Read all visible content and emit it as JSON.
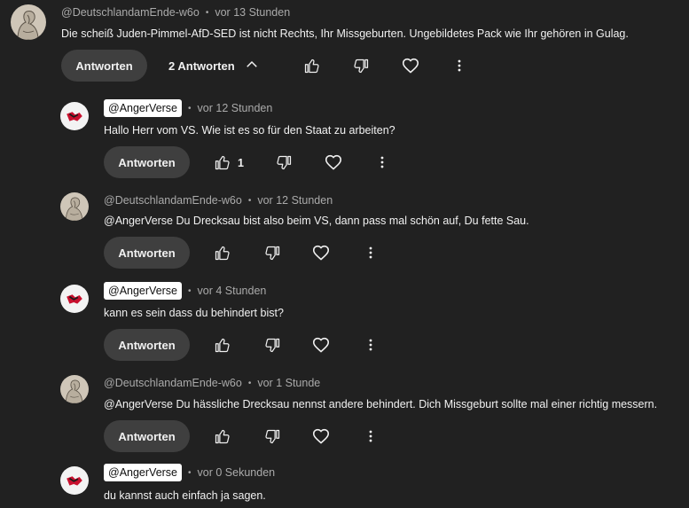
{
  "comments": [
    {
      "author": "@DeutschlandamEnde-w6o",
      "time": "vor 13 Stunden",
      "text": "Die scheiß Juden-Pimmel-AfD-SED ist nicht Rechts, Ihr Missgeburten.  Ungebildetes Pack wie Ihr gehören in Gulag.",
      "reply_label": "Antworten",
      "replies_toggle": "2 Antworten"
    },
    {
      "author": "@AngerVerse",
      "time": "vor 12 Stunden",
      "text": "Hallo Herr vom VS. Wie ist es so für den Staat zu arbeiten?",
      "reply_label": "Antworten",
      "like_count": "1"
    },
    {
      "author": "@DeutschlandamEnde-w6o",
      "time": "vor 12 Stunden",
      "text": "@AngerVerse Du Drecksau bist also beim VS, dann pass mal schön auf, Du fette Sau.",
      "reply_label": "Antworten"
    },
    {
      "author": "@AngerVerse",
      "time": "vor 4 Stunden",
      "text": "kann es sein dass du behindert bist?",
      "reply_label": "Antworten"
    },
    {
      "author": "@DeutschlandamEnde-w6o",
      "time": "vor 1 Stunde",
      "text": "@AngerVerse Du hässliche Drecksau nennst andere behindert. Dich Missgeburt sollte mal einer richtig messern.",
      "reply_label": "Antworten"
    },
    {
      "author": "@AngerVerse",
      "time": "vor 0 Sekunden",
      "text": "du kannst auch einfach ja sagen."
    }
  ],
  "separator": "•",
  "icons": {
    "like": "thumbs-up-icon",
    "dislike": "thumbs-down-icon",
    "heart": "heart-icon",
    "more": "more-vert-icon",
    "collapse": "chevron-up-icon"
  },
  "colors": {
    "background": "#212121",
    "button": "#3f3f3f",
    "text": "#f1f1f1",
    "meta": "#aaaaaa",
    "avatar_red": "#c8102e"
  }
}
